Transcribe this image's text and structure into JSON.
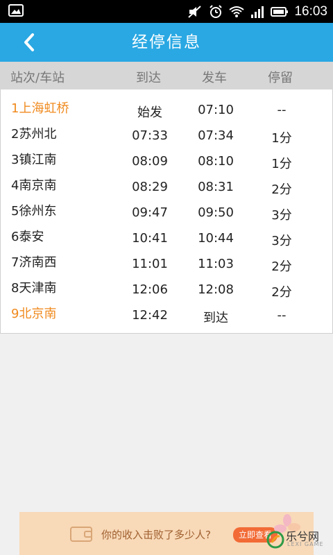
{
  "status_bar": {
    "time": "16:03"
  },
  "header": {
    "title": "经停信息"
  },
  "table": {
    "columns": [
      "站次/车站",
      "到达",
      "发车",
      "停留"
    ],
    "rows": [
      {
        "station": "1上海虹桥",
        "arrive": "始发",
        "depart": "07:10",
        "stay": "--",
        "highlight": true
      },
      {
        "station": "2苏州北",
        "arrive": "07:33",
        "depart": "07:34",
        "stay": "1分",
        "highlight": false
      },
      {
        "station": "3镇江南",
        "arrive": "08:09",
        "depart": "08:10",
        "stay": "1分",
        "highlight": false
      },
      {
        "station": "4南京南",
        "arrive": "08:29",
        "depart": "08:31",
        "stay": "2分",
        "highlight": false
      },
      {
        "station": "5徐州东",
        "arrive": "09:47",
        "depart": "09:50",
        "stay": "3分",
        "highlight": false
      },
      {
        "station": "6泰安",
        "arrive": "10:41",
        "depart": "10:44",
        "stay": "3分",
        "highlight": false
      },
      {
        "station": "7济南西",
        "arrive": "11:01",
        "depart": "11:03",
        "stay": "2分",
        "highlight": false
      },
      {
        "station": "8天津南",
        "arrive": "12:06",
        "depart": "12:08",
        "stay": "2分",
        "highlight": false
      },
      {
        "station": "9北京南",
        "arrive": "12:42",
        "depart": "到达",
        "stay": "--",
        "highlight": true
      }
    ]
  },
  "ad": {
    "text": "你的收入击败了多少人?",
    "button": "立即查看",
    "logo_text": "乐兮网",
    "logo_sub": "LEXI GAME"
  },
  "colors": {
    "header_bg": "#29a8e3",
    "highlight": "#f08a1e"
  }
}
